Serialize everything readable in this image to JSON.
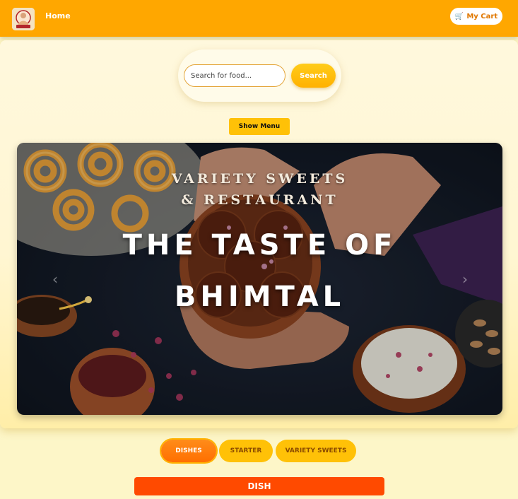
{
  "nav": {
    "home_label": "Home",
    "cart_label": "My Cart",
    "cart_icon": "🛒"
  },
  "search": {
    "placeholder": "Search for food...",
    "button_label": "Search"
  },
  "menu_button_label": "Show Menu",
  "carousel": {
    "line1": "VARIETY SWEETS",
    "line2": "& RESTAURANT",
    "line3": "THE TASTE OF",
    "line4": "BHIMTAL",
    "prev_icon": "‹",
    "next_icon": "›"
  },
  "tabs": [
    {
      "label": "DISHES",
      "active": true
    },
    {
      "label": "STARTER",
      "active": false
    },
    {
      "label": "VARIETY SWEETS",
      "active": false
    }
  ],
  "section_heading": "DISH",
  "colors": {
    "navbar": "#ffa700",
    "accent": "#ffc107",
    "active_tab": "#ff6f00",
    "section_bar": "#ff4a00"
  }
}
